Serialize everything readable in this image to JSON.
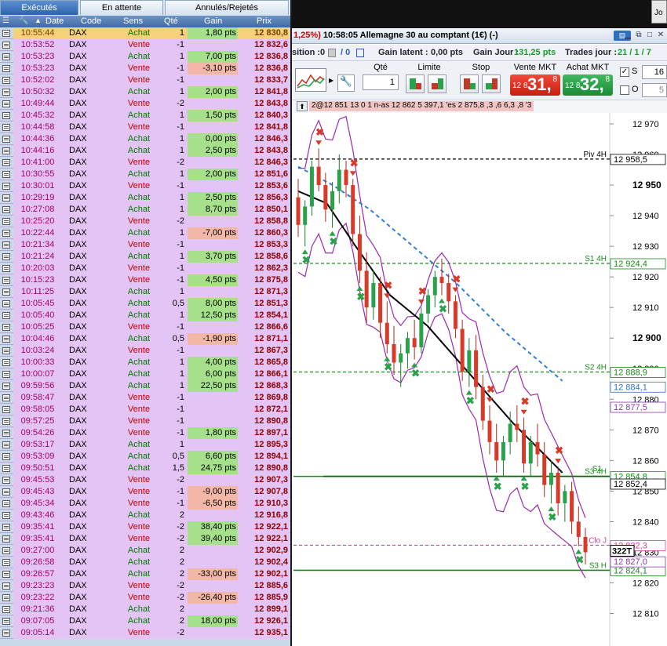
{
  "tabs": {
    "executes": "Exécutés",
    "attente": "En attente",
    "annules": "Annulés/Rejetés"
  },
  "header": {
    "date": "Date",
    "code": "Code",
    "sens": "Sens",
    "qte": "Qté",
    "gain": "Gain",
    "prix": "Prix"
  },
  "trades": [
    {
      "time": "10:55:44",
      "code": "DAX",
      "sens": "Achat",
      "qte": "1",
      "gain": "1,80 pts",
      "prix": "12 830,8"
    },
    {
      "time": "10:53:52",
      "code": "DAX",
      "sens": "Vente",
      "qte": "-1",
      "gain": "",
      "prix": "12 832,6"
    },
    {
      "time": "10:53:23",
      "code": "DAX",
      "sens": "Achat",
      "qte": "1",
      "gain": "7,00 pts",
      "prix": "12 836,8"
    },
    {
      "time": "10:53:23",
      "code": "DAX",
      "sens": "Vente",
      "qte": "-1",
      "gain": "-3,10 pts",
      "prix": "12 836,8"
    },
    {
      "time": "10:52:02",
      "code": "DAX",
      "sens": "Vente",
      "qte": "-1",
      "gain": "",
      "prix": "12 833,7"
    },
    {
      "time": "10:50:32",
      "code": "DAX",
      "sens": "Achat",
      "qte": "1",
      "gain": "2,00 pts",
      "prix": "12 841,8"
    },
    {
      "time": "10:49:44",
      "code": "DAX",
      "sens": "Vente",
      "qte": "-2",
      "gain": "",
      "prix": "12 843,8"
    },
    {
      "time": "10:45:32",
      "code": "DAX",
      "sens": "Achat",
      "qte": "1",
      "gain": "1,50 pts",
      "prix": "12 840,3"
    },
    {
      "time": "10:44:58",
      "code": "DAX",
      "sens": "Vente",
      "qte": "-1",
      "gain": "",
      "prix": "12 841,8"
    },
    {
      "time": "10:44:36",
      "code": "DAX",
      "sens": "Achat",
      "qte": "1",
      "gain": "0,00 pts",
      "prix": "12 846,3"
    },
    {
      "time": "10:44:16",
      "code": "DAX",
      "sens": "Achat",
      "qte": "1",
      "gain": "2,50 pts",
      "prix": "12 843,8"
    },
    {
      "time": "10:41:00",
      "code": "DAX",
      "sens": "Vente",
      "qte": "-2",
      "gain": "",
      "prix": "12 846,3"
    },
    {
      "time": "10:30:55",
      "code": "DAX",
      "sens": "Achat",
      "qte": "1",
      "gain": "2,00 pts",
      "prix": "12 851,6"
    },
    {
      "time": "10:30:01",
      "code": "DAX",
      "sens": "Vente",
      "qte": "-1",
      "gain": "",
      "prix": "12 853,6"
    },
    {
      "time": "10:29:19",
      "code": "DAX",
      "sens": "Achat",
      "qte": "1",
      "gain": "2,50 pts",
      "prix": "12 856,3"
    },
    {
      "time": "10:27:08",
      "code": "DAX",
      "sens": "Achat",
      "qte": "1",
      "gain": "8,70 pts",
      "prix": "12 850,1"
    },
    {
      "time": "10:25:20",
      "code": "DAX",
      "sens": "Vente",
      "qte": "-2",
      "gain": "",
      "prix": "12 858,8"
    },
    {
      "time": "10:22:44",
      "code": "DAX",
      "sens": "Achat",
      "qte": "1",
      "gain": "-7,00 pts",
      "prix": "12 860,3"
    },
    {
      "time": "10:21:34",
      "code": "DAX",
      "sens": "Vente",
      "qte": "-1",
      "gain": "",
      "prix": "12 853,3"
    },
    {
      "time": "10:21:24",
      "code": "DAX",
      "sens": "Achat",
      "qte": "1",
      "gain": "3,70 pts",
      "prix": "12 858,6"
    },
    {
      "time": "10:20:03",
      "code": "DAX",
      "sens": "Vente",
      "qte": "-1",
      "gain": "",
      "prix": "12 862,3"
    },
    {
      "time": "10:15:23",
      "code": "DAX",
      "sens": "Vente",
      "qte": "-1",
      "gain": "4,50 pts",
      "prix": "12 875,8"
    },
    {
      "time": "10:11:25",
      "code": "DAX",
      "sens": "Achat",
      "qte": "1",
      "gain": "",
      "prix": "12 871,3"
    },
    {
      "time": "10:05:45",
      "code": "DAX",
      "sens": "Achat",
      "qte": "0,5",
      "gain": "8,00 pts",
      "prix": "12 851,3"
    },
    {
      "time": "10:05:40",
      "code": "DAX",
      "sens": "Achat",
      "qte": "1",
      "gain": "12,50 pts",
      "prix": "12 854,1"
    },
    {
      "time": "10:05:25",
      "code": "DAX",
      "sens": "Vente",
      "qte": "-1",
      "gain": "",
      "prix": "12 866,6"
    },
    {
      "time": "10:04:46",
      "code": "DAX",
      "sens": "Achat",
      "qte": "0,5",
      "gain": "-1,90 pts",
      "prix": "12 871,1"
    },
    {
      "time": "10:03:24",
      "code": "DAX",
      "sens": "Vente",
      "qte": "-1",
      "gain": "",
      "prix": "12 867,3"
    },
    {
      "time": "10:00:33",
      "code": "DAX",
      "sens": "Achat",
      "qte": "1",
      "gain": "4,00 pts",
      "prix": "12 865,8"
    },
    {
      "time": "10:00:07",
      "code": "DAX",
      "sens": "Achat",
      "qte": "1",
      "gain": "6,00 pts",
      "prix": "12 866,1"
    },
    {
      "time": "09:59:56",
      "code": "DAX",
      "sens": "Achat",
      "qte": "1",
      "gain": "22,50 pts",
      "prix": "12 868,3"
    },
    {
      "time": "09:58:47",
      "code": "DAX",
      "sens": "Vente",
      "qte": "-1",
      "gain": "",
      "prix": "12 869,8"
    },
    {
      "time": "09:58:05",
      "code": "DAX",
      "sens": "Vente",
      "qte": "-1",
      "gain": "",
      "prix": "12 872,1"
    },
    {
      "time": "09:57:25",
      "code": "DAX",
      "sens": "Vente",
      "qte": "-1",
      "gain": "",
      "prix": "12 890,8"
    },
    {
      "time": "09:54:26",
      "code": "DAX",
      "sens": "Vente",
      "qte": "-1",
      "gain": "1,80 pts",
      "prix": "12 897,1"
    },
    {
      "time": "09:53:17",
      "code": "DAX",
      "sens": "Achat",
      "qte": "1",
      "gain": "",
      "prix": "12 895,3"
    },
    {
      "time": "09:53:09",
      "code": "DAX",
      "sens": "Achat",
      "qte": "0,5",
      "gain": "6,60 pts",
      "prix": "12 894,1"
    },
    {
      "time": "09:50:51",
      "code": "DAX",
      "sens": "Achat",
      "qte": "1,5",
      "gain": "24,75 pts",
      "prix": "12 890,8"
    },
    {
      "time": "09:45:53",
      "code": "DAX",
      "sens": "Vente",
      "qte": "-2",
      "gain": "",
      "prix": "12 907,3"
    },
    {
      "time": "09:45:43",
      "code": "DAX",
      "sens": "Vente",
      "qte": "-1",
      "gain": "-9,00 pts",
      "prix": "12 907,8"
    },
    {
      "time": "09:45:34",
      "code": "DAX",
      "sens": "Vente",
      "qte": "-1",
      "gain": "-6,50 pts",
      "prix": "12 910,3"
    },
    {
      "time": "09:43:46",
      "code": "DAX",
      "sens": "Achat",
      "qte": "2",
      "gain": "",
      "prix": "12 916,8"
    },
    {
      "time": "09:35:41",
      "code": "DAX",
      "sens": "Vente",
      "qte": "-2",
      "gain": "38,40 pts",
      "prix": "12 922,1"
    },
    {
      "time": "09:35:41",
      "code": "DAX",
      "sens": "Vente",
      "qte": "-2",
      "gain": "39,40 pts",
      "prix": "12 922,1"
    },
    {
      "time": "09:27:00",
      "code": "DAX",
      "sens": "Achat",
      "qte": "2",
      "gain": "",
      "prix": "12 902,9"
    },
    {
      "time": "09:26:58",
      "code": "DAX",
      "sens": "Achat",
      "qte": "2",
      "gain": "",
      "prix": "12 902,4"
    },
    {
      "time": "09:26:57",
      "code": "DAX",
      "sens": "Achat",
      "qte": "2",
      "gain": "-33,00 pts",
      "prix": "12 902,1"
    },
    {
      "time": "09:23:23",
      "code": "DAX",
      "sens": "Vente",
      "qte": "-2",
      "gain": "",
      "prix": "12 885,6"
    },
    {
      "time": "09:23:22",
      "code": "DAX",
      "sens": "Vente",
      "qte": "-2",
      "gain": "-26,40 pts",
      "prix": "12 885,9"
    },
    {
      "time": "09:21:36",
      "code": "DAX",
      "sens": "Achat",
      "qte": "2",
      "gain": "",
      "prix": "12 899,1"
    },
    {
      "time": "09:07:05",
      "code": "DAX",
      "sens": "Achat",
      "qte": "2",
      "gain": "18,00 pts",
      "prix": "12 926,1"
    },
    {
      "time": "09:05:14",
      "code": "DAX",
      "sens": "Vente",
      "qte": "-2",
      "gain": "",
      "prix": "12 935,1"
    }
  ],
  "topstrip": {
    "mini_label": "Jo"
  },
  "window": {
    "title_prefix": "1,25%)",
    "title_time": "10:58:05",
    "title_text": "Allemagne 30 au comptant (1€) (-)",
    "kbd": "▤"
  },
  "info": {
    "position_label": "sition :",
    "position_val": "0",
    "pos2": "/ 0",
    "gain_latent_label": "Gain latent :",
    "gain_latent": "0,00 pts",
    "gain_jour_label": "Gain Jour :",
    "gain_jour": "131,25 pts",
    "trades_label": "Trades jour :",
    "trades_val": "21 / 1 / 7"
  },
  "toolbar": {
    "qte_label": "Qté",
    "qte_value": "1",
    "limite_label": "Limite",
    "stop_label": "Stop",
    "vente_label": "Vente MKT",
    "achat_label": "Achat MKT",
    "vente_small": "12 8",
    "vente_big": "31,",
    "vente_sup": "8",
    "achat_small": "12 8",
    "achat_big": "32,",
    "achat_sup": "8",
    "s_label": "S",
    "s_value": "16",
    "o_label": "O",
    "o_value": "5"
  },
  "bar2": {
    "text": "2@12 851 13 0 1 n-as 12 862 5 397,1 'es 2 875,8 ,3 ,6 6,3 ,8 '3"
  },
  "chart_data": {
    "type": "candlestick",
    "y_ticks": [
      "12 970",
      "12 960",
      "12 950",
      "12 940",
      "12 930",
      "12 920",
      "12 910",
      "12 900",
      "12 890",
      "12 880",
      "12 870",
      "12 860",
      "12 850",
      "12 840",
      "12 830",
      "12 820",
      "12 810"
    ],
    "ylim": [
      12805,
      12970
    ],
    "levels": [
      {
        "label": "Piv 4H",
        "value": 12958.5,
        "tag": "12 958,5",
        "color": "#000000"
      },
      {
        "label": "S1 4H",
        "value": 12924.4,
        "tag": "12 924,4",
        "color": "#1a8a1a"
      },
      {
        "label": "S2 4H",
        "value": 12888.9,
        "tag": "12 888,9",
        "color": "#1a8a1a"
      },
      {
        "label": "S3 4H",
        "value": 12854.8,
        "tag": "12 854,8",
        "color": "#1a8a1a"
      },
      {
        "label": "Clo J",
        "value": 12832.3,
        "tag": "12 832,3",
        "color": "#d040a0"
      },
      {
        "label": "S3 H",
        "value": 12824.1,
        "tag": "12 824,1",
        "color": "#1a8a1a"
      }
    ],
    "extra_tags": [
      {
        "value": 12884.1,
        "tag": "12 884,1",
        "color": "#3070c0"
      },
      {
        "value": 12877.5,
        "tag": "12 877,5",
        "color": "#8a3aa8"
      },
      {
        "value": 12852.4,
        "tag": "12 852,4",
        "color": "#000000"
      },
      {
        "value": 12827.0,
        "tag": "12 827,0",
        "color": "#8a3aa8"
      }
    ],
    "price_tag": "322T",
    "price_value": 12830.5,
    "level_label_s1": "S1",
    "candles": [
      [
        12946,
        12952,
        12933,
        12937
      ],
      [
        12937,
        12945,
        12930,
        12943
      ],
      [
        12943,
        12958,
        12940,
        12956
      ],
      [
        12956,
        12962,
        12948,
        12950
      ],
      [
        12950,
        12954,
        12938,
        12942
      ],
      [
        12942,
        12951,
        12936,
        12948
      ],
      [
        12948,
        12960,
        12944,
        12955
      ],
      [
        12955,
        12958,
        12946,
        12950
      ],
      [
        12950,
        12952,
        12930,
        12934
      ],
      [
        12934,
        12940,
        12918,
        12922
      ],
      [
        12922,
        12928,
        12905,
        12910
      ],
      [
        12910,
        12922,
        12906,
        12918
      ],
      [
        12918,
        12920,
        12900,
        12905
      ],
      [
        12905,
        12912,
        12895,
        12898
      ],
      [
        12898,
        12904,
        12888,
        12892
      ],
      [
        12892,
        12898,
        12884,
        12895
      ],
      [
        12895,
        12902,
        12890,
        12900
      ],
      [
        12900,
        12906,
        12893,
        12897
      ],
      [
        12897,
        12910,
        12895,
        12908
      ],
      [
        12908,
        12916,
        12905,
        12914
      ],
      [
        12914,
        12922,
        12910,
        12920
      ],
      [
        12920,
        12926,
        12914,
        12918
      ],
      [
        12918,
        12921,
        12908,
        12912
      ],
      [
        12912,
        12914,
        12900,
        12903
      ],
      [
        12903,
        12906,
        12886,
        12889
      ],
      [
        12889,
        12900,
        12884,
        12896
      ],
      [
        12896,
        12901,
        12880,
        12884
      ],
      [
        12884,
        12888,
        12870,
        12873
      ],
      [
        12873,
        12878,
        12862,
        12866
      ],
      [
        12866,
        12872,
        12856,
        12860
      ],
      [
        12860,
        12868,
        12855,
        12866
      ],
      [
        12866,
        12876,
        12862,
        12872
      ],
      [
        12872,
        12878,
        12866,
        12870
      ],
      [
        12870,
        12874,
        12856,
        12859
      ],
      [
        12859,
        12868,
        12855,
        12866
      ],
      [
        12866,
        12872,
        12858,
        12862
      ],
      [
        12862,
        12866,
        12848,
        12852
      ],
      [
        12852,
        12860,
        12846,
        12856
      ],
      [
        12856,
        12858,
        12842,
        12846
      ],
      [
        12846,
        12852,
        12840,
        12850
      ],
      [
        12850,
        12853,
        12836,
        12840
      ],
      [
        12840,
        12845,
        12832,
        12835
      ],
      [
        12835,
        12838,
        12826,
        12830
      ]
    ],
    "sma_dashed_blue": [
      [
        12956,
        0
      ],
      [
        12950,
        0.12
      ],
      [
        12942,
        0.25
      ],
      [
        12930,
        0.4
      ],
      [
        12918,
        0.55
      ],
      [
        12902,
        0.72
      ],
      [
        12886,
        0.92
      ]
    ],
    "sma_black": [
      [
        12948,
        0
      ],
      [
        12944,
        0.1
      ],
      [
        12930,
        0.2
      ],
      [
        12914,
        0.32
      ],
      [
        12904,
        0.45
      ],
      [
        12888,
        0.6
      ],
      [
        12872,
        0.75
      ],
      [
        12856,
        0.92
      ]
    ]
  }
}
